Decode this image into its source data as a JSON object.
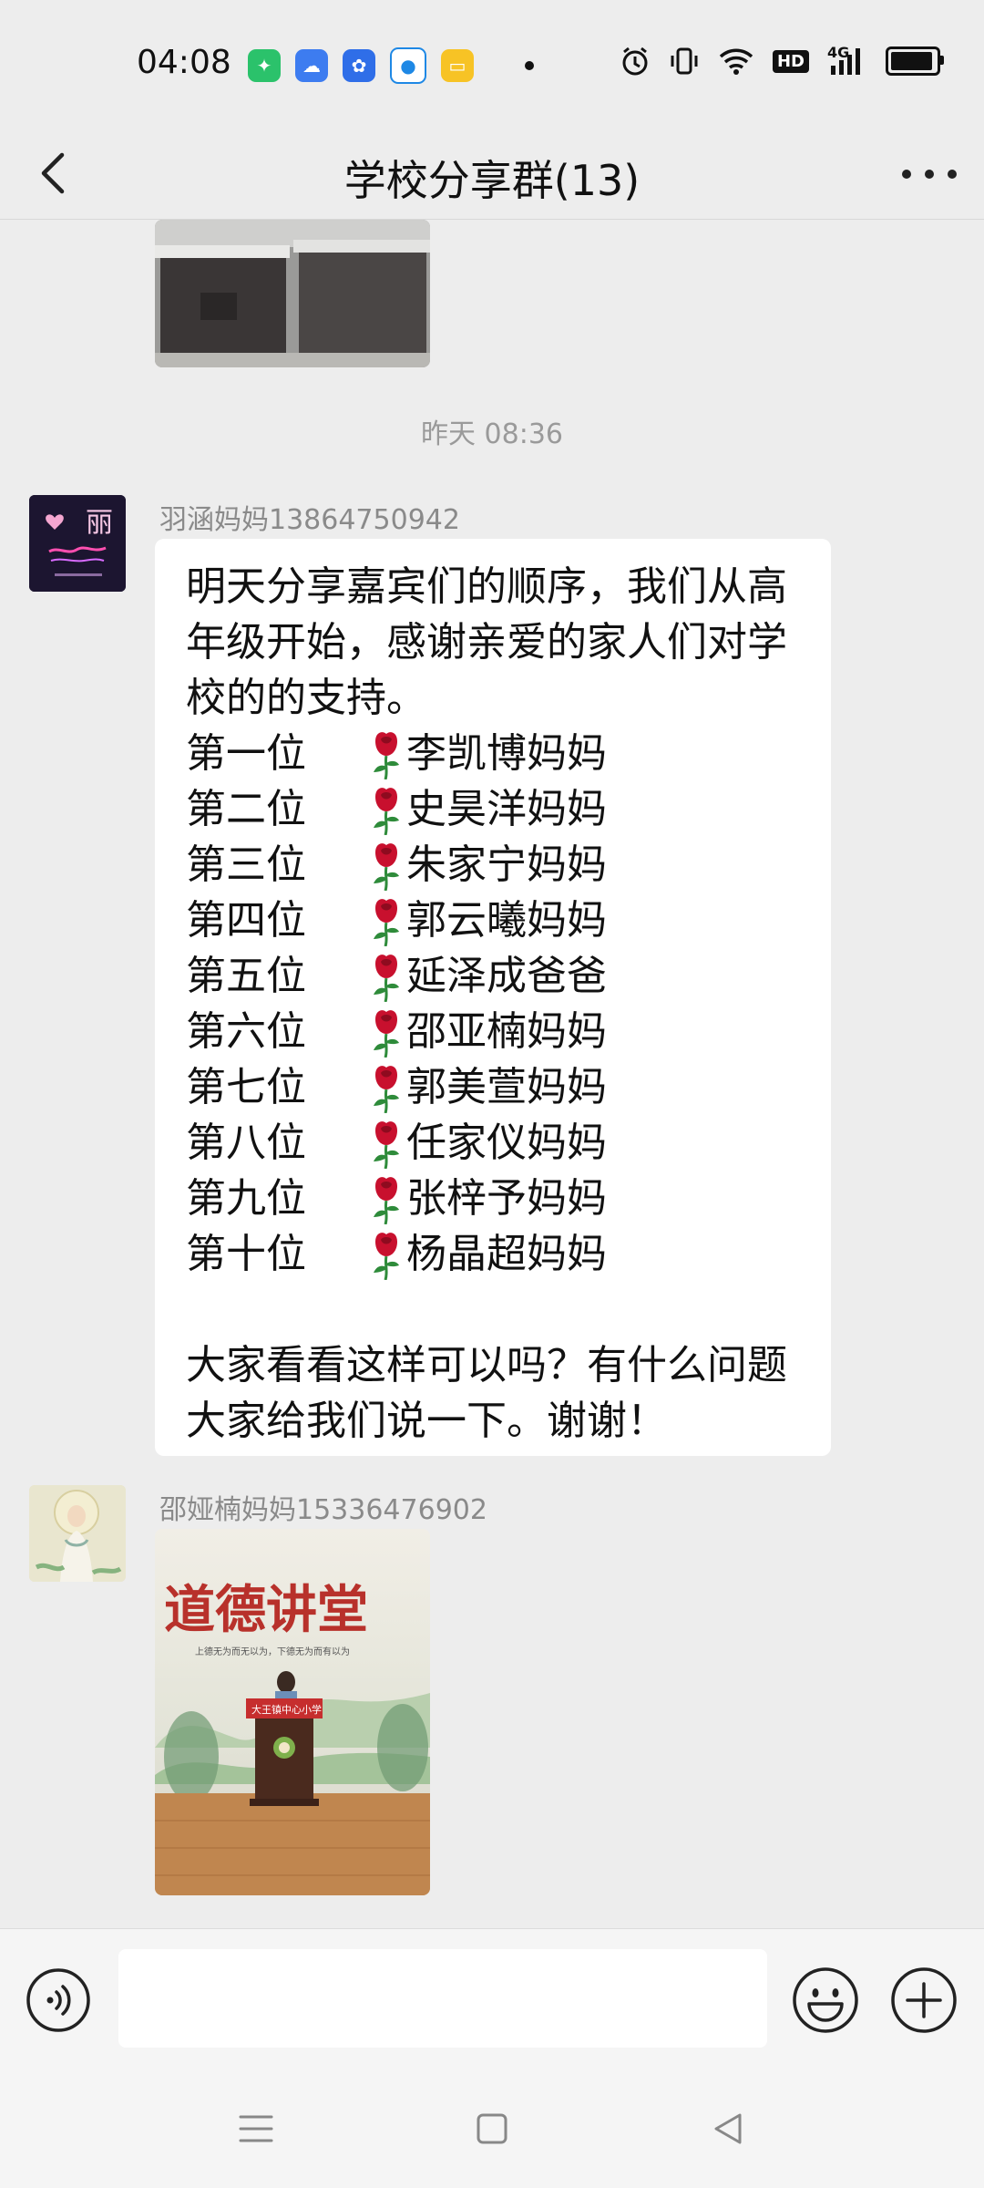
{
  "status_bar": {
    "time": "04:08",
    "network": "4G",
    "hd": "HD"
  },
  "header": {
    "title": "学校分享群(13)"
  },
  "chat": {
    "timestamp": "昨天 08:36",
    "message1": {
      "sender": "羽涵妈妈13864750942",
      "intro": [
        "明天分享嘉宾们的顺序，我们从高",
        "年级开始，感谢亲爱的家人们对学",
        "校的的支持。"
      ],
      "ranks": [
        {
          "rank": "第一位",
          "name": "李凯博妈妈"
        },
        {
          "rank": "第二位",
          "name": "史昊洋妈妈"
        },
        {
          "rank": "第三位",
          "name": "朱家宁妈妈"
        },
        {
          "rank": "第四位",
          "name": "郭云曦妈妈"
        },
        {
          "rank": "第五位",
          "name": "延泽成爸爸"
        },
        {
          "rank": "第六位",
          "name": "邵亚楠妈妈"
        },
        {
          "rank": "第七位",
          "name": "郭美萱妈妈"
        },
        {
          "rank": "第八位",
          "name": "任家仪妈妈"
        },
        {
          "rank": "第九位",
          "name": "张梓予妈妈"
        },
        {
          "rank": "第十位",
          "name": "杨晶超妈妈"
        }
      ],
      "closing": [
        "大家看看这样可以吗？有什么问题",
        "大家给我们说一下。谢谢！"
      ]
    },
    "message2": {
      "sender": "邵娅楠妈妈15336476902",
      "image": {
        "banner_text": "道德讲堂",
        "subtitle": "上德无为而无以为，下德无为而有以为",
        "podium_text": "大王镇中心小学"
      }
    },
    "avatar1_text": "丽"
  },
  "input": {
    "placeholder": ""
  },
  "colors": {
    "background": "#ededed",
    "bubble": "#ffffff",
    "rose": "#c8102e",
    "stem": "#2e8b3a"
  }
}
